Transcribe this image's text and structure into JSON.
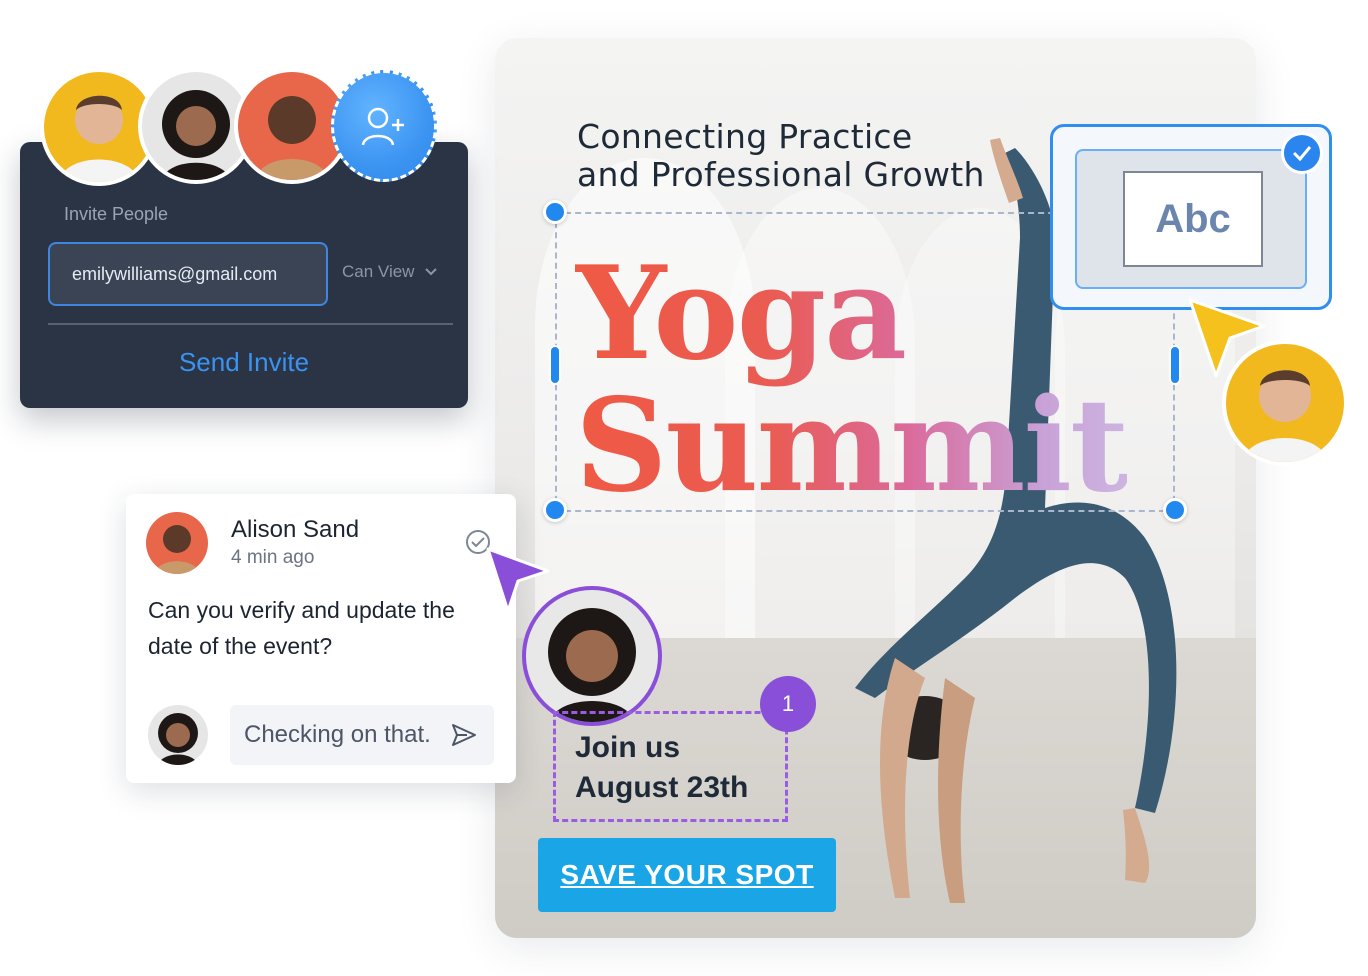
{
  "invite_panel": {
    "label": "Invite People",
    "email_value": "emilywilliams@gmail.com",
    "permission": "Can View",
    "send_label": "Send Invite",
    "add_user_icon": "user-plus-icon"
  },
  "poster": {
    "subtitle_line1": "Connecting Practice",
    "subtitle_line2": "and Professional Growth",
    "title_line1": "Yoga",
    "title_line2": "Summit",
    "join_line1": "Join us",
    "join_line2": "August 23th",
    "cta_label": "SAVE YOUR SPOT",
    "cta_color": "#1aa6e6"
  },
  "comment": {
    "author": "Alison Sand",
    "time": "4 min ago",
    "text": "Can you verify and update the date of the event?",
    "reply_text": "Checking on that.",
    "resolve_icon": "check-circle-icon",
    "send_icon": "send-icon"
  },
  "font_picker": {
    "sample": "Abc",
    "check_icon": "check-icon"
  },
  "step_badge": "1"
}
